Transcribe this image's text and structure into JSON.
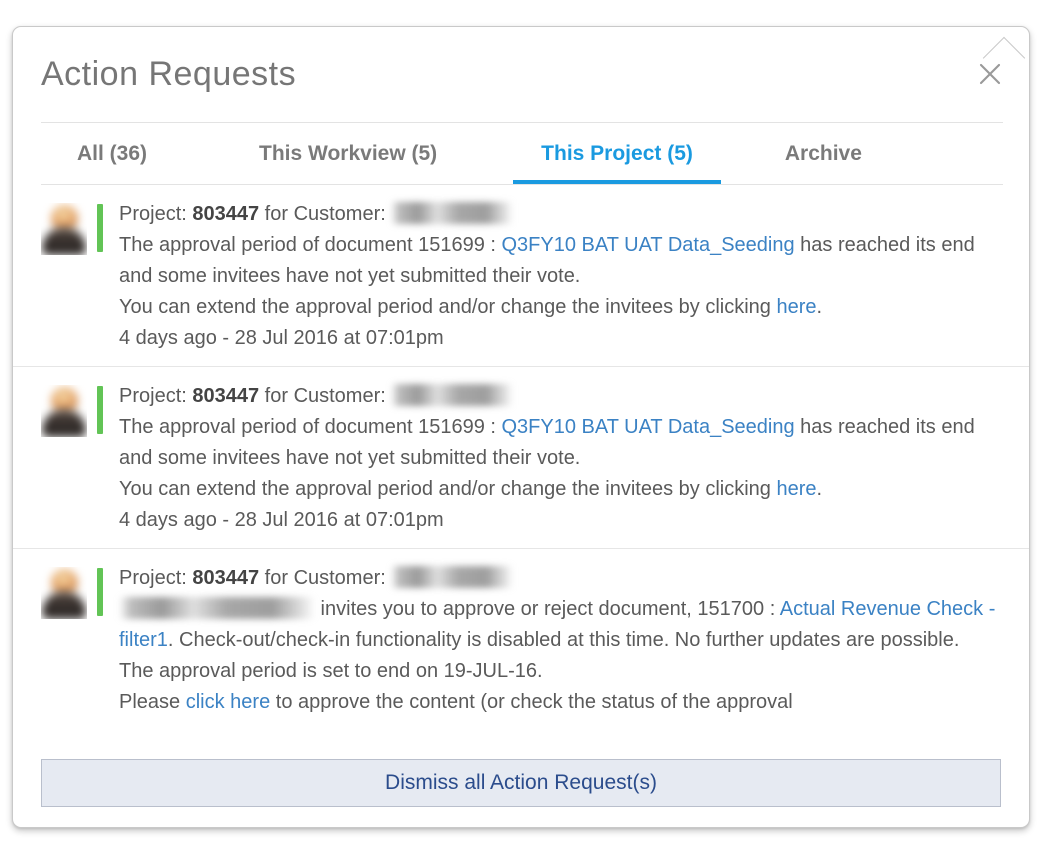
{
  "popover": {
    "title": "Action Requests",
    "close_icon": "close-icon"
  },
  "tabs": [
    {
      "label": "All (36)",
      "active": false
    },
    {
      "label": "This Workview (5)",
      "active": false
    },
    {
      "label": "This Project (5)",
      "active": true
    },
    {
      "label": "Archive",
      "active": false
    }
  ],
  "items": [
    {
      "project_prefix": "Project: ",
      "project_id": "803447",
      "customer_label": " for Customer: ",
      "customer_redacted": "",
      "line2_pre": "The approval period of document 151699 : ",
      "line2_link": "Q3FY10 BAT UAT Data_Seeding",
      "line2_post": " has reached its end and some invitees have not yet submitted their vote.",
      "line3_pre": "You can extend the approval period and/or change the invitees by clicking ",
      "line3_link": "here",
      "line3_post": ".",
      "timestamp": "4 days ago - 28 Jul 2016 at 07:01pm"
    },
    {
      "project_prefix": "Project: ",
      "project_id": "803447",
      "customer_label": " for Customer: ",
      "customer_redacted": "",
      "line2_pre": "The approval period of document 151699 : ",
      "line2_link": "Q3FY10 BAT UAT Data_Seeding",
      "line2_post": " has reached its end and some invitees have not yet submitted their vote.",
      "line3_pre": "You can extend the approval period and/or change the invitees by clicking ",
      "line3_link": "here",
      "line3_post": ".",
      "timestamp": "4 days ago - 28 Jul 2016 at 07:01pm"
    },
    {
      "project_prefix": "Project: ",
      "project_id": "803447",
      "customer_label": " for Customer: ",
      "customer_redacted": "",
      "sender_redacted": "",
      "line2_pre": " invites you to approve or reject document, 151700 : ",
      "line2_link": "Actual Revenue Check - filter1",
      "line2_post": ". Check-out/check-in functionality is disabled at this time. No further updates are possible.",
      "line3": "The approval period is set to end on 19-JUL-16.",
      "line4_pre": "Please ",
      "line4_link": "click here",
      "line4_post": " to approve the content (or check the status of the approval"
    }
  ],
  "dismiss": {
    "label": "Dismiss all Action Request(s)"
  },
  "colors": {
    "accent_blue": "#1a9ae0",
    "link_blue": "#3b82c4",
    "green_bar": "#62c456",
    "dismiss_bg": "#e6eaf2",
    "dismiss_text": "#2b4c8c"
  }
}
